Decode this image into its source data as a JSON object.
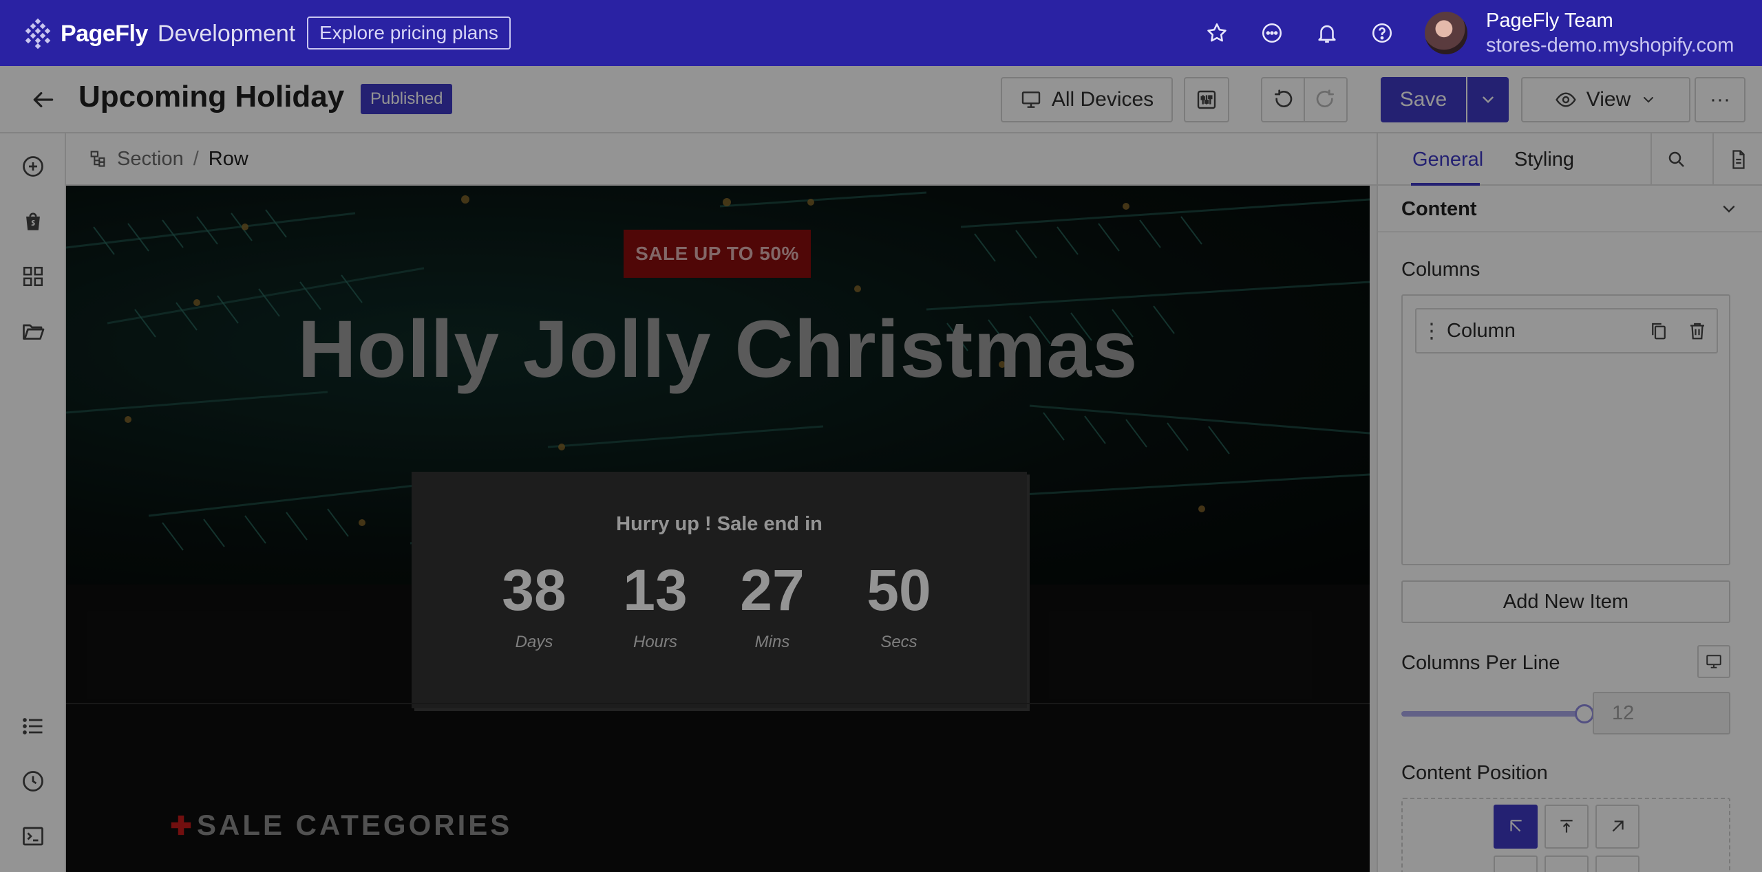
{
  "app": {
    "logo_text": "PageFly",
    "logo_sub": "Development",
    "pricing_label": "Explore pricing plans"
  },
  "user": {
    "name": "PageFly Team",
    "store": "stores-demo.myshopify.com"
  },
  "toolbar": {
    "page_title": "Upcoming Holiday",
    "status_badge": "Published",
    "devices_label": "All Devices",
    "save_label": "Save",
    "view_label": "View",
    "more_label": "···"
  },
  "breadcrumb": {
    "section": "Section",
    "separator": "/",
    "row": "Row"
  },
  "canvas": {
    "sale_badge": "SALE UP TO 50%",
    "hero_title": "Holly Jolly Christmas",
    "countdown_heading": "Hurry up ! Sale end in",
    "countdown": [
      {
        "value": "38",
        "label": "Days"
      },
      {
        "value": "13",
        "label": "Hours"
      },
      {
        "value": "27",
        "label": "Mins"
      },
      {
        "value": "50",
        "label": "Secs"
      }
    ],
    "section_heading": "SALE CATEGORIES"
  },
  "panel": {
    "tab_general": "General",
    "tab_styling": "Styling",
    "content_title": "Content",
    "columns_label": "Columns",
    "column_item": "Column",
    "add_item": "Add New Item",
    "columns_per_line_label": "Columns Per Line",
    "columns_per_line_value": "12",
    "content_position_label": "Content Position"
  },
  "colors": {
    "brand": "#2a22a3",
    "accent": "#3f39c4",
    "sale_red": "#8a0d0d"
  },
  "icons": [
    "star-icon",
    "chat-icon",
    "bell-icon",
    "help-icon",
    "back-arrow-icon",
    "monitor-icon",
    "sliders-icon",
    "undo-icon",
    "redo-icon",
    "eye-icon",
    "chevron-down-icon",
    "plus-circle-icon",
    "shopify-bag-icon",
    "grid-icon",
    "folder-icon",
    "list-icon",
    "clock-icon",
    "terminal-icon",
    "hierarchy-icon",
    "search-icon",
    "document-icon",
    "drag-handle-icon",
    "duplicate-icon",
    "trash-icon"
  ]
}
